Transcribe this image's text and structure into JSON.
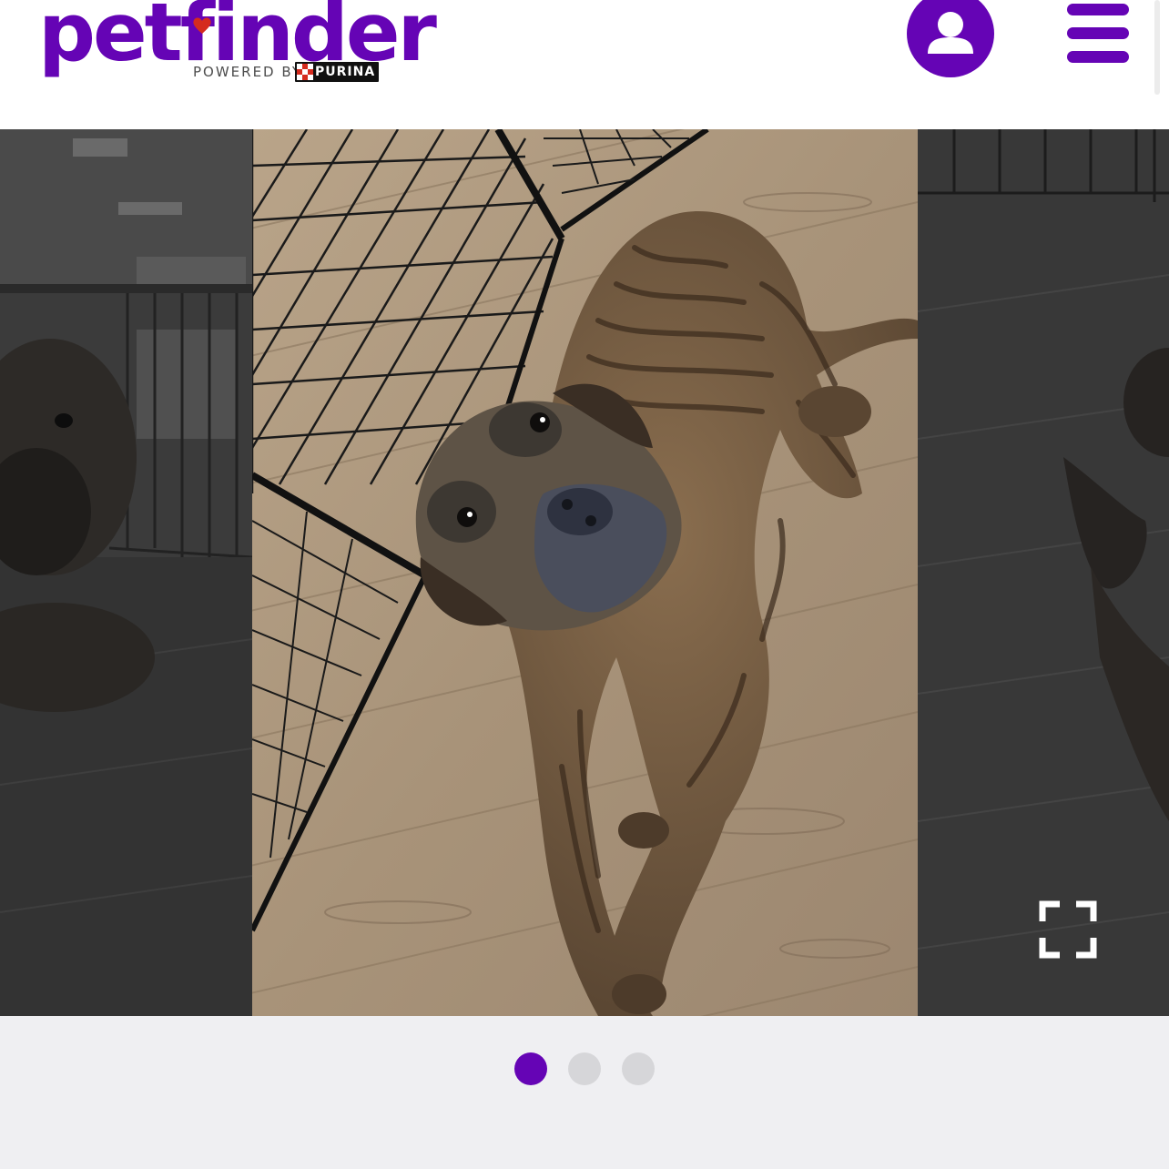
{
  "header": {
    "logo_text": "petfinder",
    "powered_by": "POWERED BY",
    "partner": "PURINA",
    "account_icon": "user-icon",
    "menu_icon": "hamburger-menu-icon"
  },
  "gallery": {
    "expand_icon": "fullscreen-expand-icon",
    "current_index": 1,
    "slides": 3,
    "pagination": [
      {
        "state": "active"
      },
      {
        "state": "inactive"
      },
      {
        "state": "inactive"
      }
    ]
  },
  "colors": {
    "brand_purple": "#6504b5",
    "dot_inactive": "#d6d6d9",
    "page_bg": "#efeff2"
  }
}
